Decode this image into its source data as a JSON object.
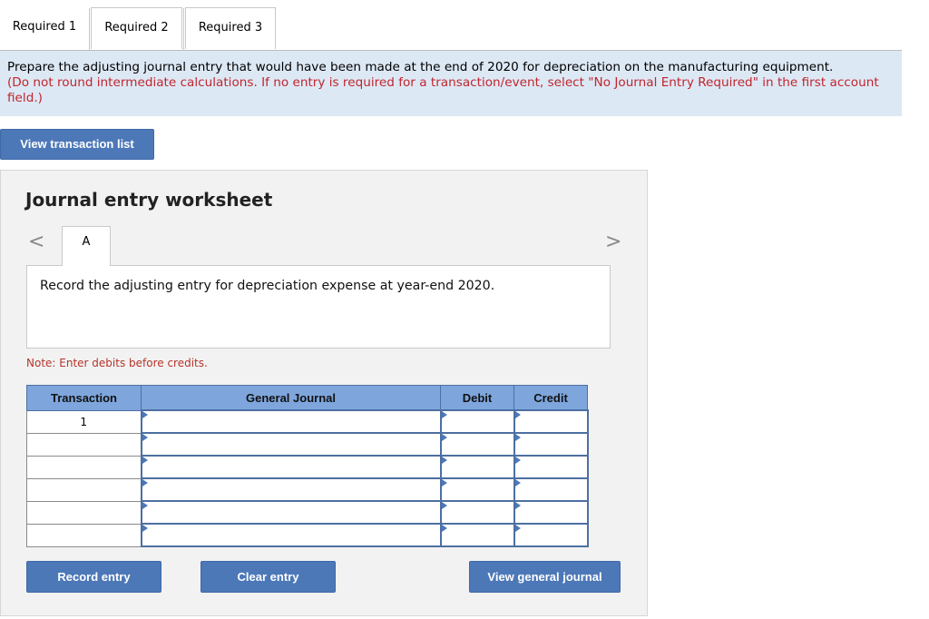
{
  "tabs": [
    "Required 1",
    "Required 2",
    "Required 3"
  ],
  "instructions": {
    "main": "Prepare the adjusting journal entry that would have been made at the end of 2020 for depreciation on the manufacturing equipment.",
    "note": "(Do not round intermediate calculations. If no entry is required for a transaction/event, select \"No Journal Entry Required\" in the first account field.)"
  },
  "view_transaction_list": "View transaction list",
  "worksheet": {
    "title": "Journal entry worksheet",
    "nav_prev": "<",
    "nav_next": ">",
    "entry_tab": "A",
    "description": "Record the adjusting entry for depreciation expense at year-end 2020.",
    "note": "Note: Enter debits before credits."
  },
  "table": {
    "headers": [
      "Transaction",
      "General Journal",
      "Debit",
      "Credit"
    ],
    "rows": [
      {
        "transaction": "1",
        "account": "",
        "debit": "",
        "credit": ""
      },
      {
        "transaction": "",
        "account": "",
        "debit": "",
        "credit": ""
      },
      {
        "transaction": "",
        "account": "",
        "debit": "",
        "credit": ""
      },
      {
        "transaction": "",
        "account": "",
        "debit": "",
        "credit": ""
      },
      {
        "transaction": "",
        "account": "",
        "debit": "",
        "credit": ""
      },
      {
        "transaction": "",
        "account": "",
        "debit": "",
        "credit": ""
      }
    ]
  },
  "buttons": {
    "record": "Record entry",
    "clear": "Clear entry",
    "view_general_journal": "View general journal"
  },
  "colors": {
    "button_bg": "#4d78b8",
    "header_bg": "#7ea6dd",
    "instruction_bg": "#dde8f5",
    "note_red": "#c0262d"
  }
}
